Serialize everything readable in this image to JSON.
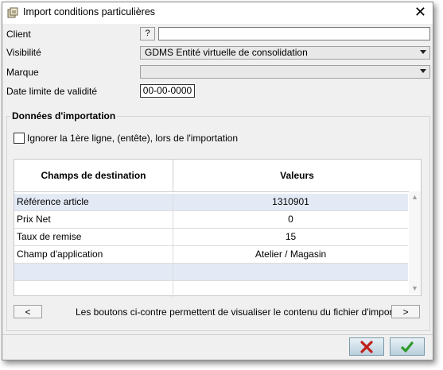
{
  "window": {
    "title": "Import conditions particulières"
  },
  "form": {
    "client_label": "Client",
    "client_help": "?",
    "client_value": "",
    "visibilite_label": "Visibilité",
    "visibilite_value": "GDMS Entité virtuelle de consolidation",
    "marque_label": "Marque",
    "marque_value": "",
    "date_label": "Date limite de validité",
    "date_value": "00-00-0000"
  },
  "import": {
    "section_title": "Données d'importation",
    "ignore_header_label": "Ignorer la 1ère ligne, (entête), lors de l'importation",
    "ignore_header_checked": false,
    "columns": [
      "Champs de destination",
      "Valeurs"
    ],
    "rows": [
      {
        "field": "Référence article",
        "value": "1310901"
      },
      {
        "field": "Prix Net",
        "value": "0"
      },
      {
        "field": "Taux de remise",
        "value": "15"
      },
      {
        "field": "Champ d'application",
        "value": "Atelier / Magasin"
      },
      {
        "field": "",
        "value": ""
      },
      {
        "field": "",
        "value": ""
      }
    ],
    "prev_label": "<",
    "next_label": ">",
    "nav_text": "Les boutons ci-contre permettent de visualiser le contenu du fichier d'import"
  },
  "footer": {
    "cancel_icon": "x-icon",
    "ok_icon": "check-icon",
    "cancel_color": "#c0201a",
    "ok_color": "#2f9a2a"
  }
}
